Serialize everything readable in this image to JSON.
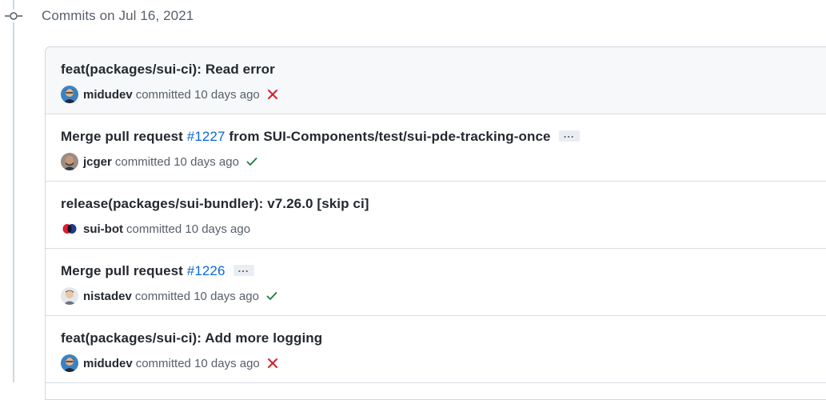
{
  "day_group": {
    "title": "Commits on Jul 16, 2021"
  },
  "commits": [
    {
      "title": "feat(packages/sui-ci): Read error",
      "author": "midudev",
      "meta": "committed 10 days ago",
      "status": "failure",
      "avatar_icon": "midudev-avatar",
      "status_icon": "x-icon",
      "status_color": "#cf222e"
    },
    {
      "title_prefix": "Merge pull request ",
      "pr_link": "#1227",
      "title_suffix": " from SUI-Components/test/sui-pde-tracking-once",
      "ellipsis": "...",
      "author": "jcger",
      "meta": "committed 10 days ago",
      "status": "success",
      "avatar_icon": "jcger-avatar",
      "status_icon": "check-icon",
      "status_color": "#1a7f37"
    },
    {
      "title": "release(packages/sui-bundler): v7.26.0 [skip ci]",
      "author": "sui-bot",
      "meta": "committed 10 days ago",
      "status": "none",
      "avatar_icon": "sui-bot-avatar"
    },
    {
      "title_prefix": "Merge pull request ",
      "pr_link": "#1226",
      "ellipsis": "...",
      "author": "nistadev",
      "meta": "committed 10 days ago",
      "status": "success",
      "avatar_icon": "nistadev-avatar",
      "status_icon": "check-icon",
      "status_color": "#1a7f37"
    },
    {
      "title": "feat(packages/sui-ci): Add more logging",
      "author": "midudev",
      "meta": "committed 10 days ago",
      "status": "failure",
      "avatar_icon": "midudev-avatar",
      "status_icon": "x-icon",
      "status_color": "#cf222e"
    }
  ],
  "colors": {
    "link": "#0969da",
    "border": "#d0d7de",
    "highlight_bg": "#f6f8fa",
    "muted_text": "#57606a"
  }
}
